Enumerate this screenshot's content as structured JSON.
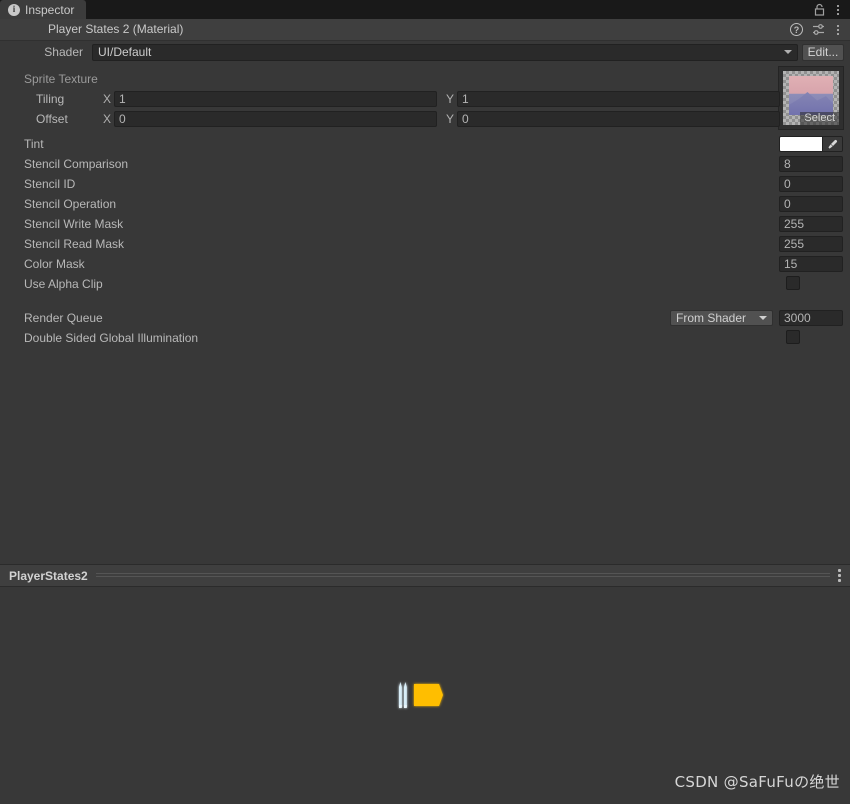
{
  "window": {
    "tab_label": "Inspector",
    "tab_icon": "info-icon",
    "lock_icon": "lock-icon",
    "tab_menu_icon": "kebab-menu-icon"
  },
  "material": {
    "title": "Player States 2 (Material)",
    "help_icon": "help-icon",
    "preset_icon": "preset-sliders-icon",
    "menu_icon": "kebab-menu-icon",
    "shader": {
      "label": "Shader",
      "value": "UI/Default",
      "edit_label": "Edit...",
      "dropdown_icon": "chevron-down-icon"
    }
  },
  "properties": {
    "sprite_texture": {
      "label": "Sprite Texture",
      "select_label": "Select",
      "tiling": {
        "label": "Tiling",
        "x_axis": "X",
        "x": "1",
        "y_axis": "Y",
        "y": "1"
      },
      "offset": {
        "label": "Offset",
        "x_axis": "X",
        "x": "0",
        "y_axis": "Y",
        "y": "0"
      }
    },
    "tint": {
      "label": "Tint",
      "color": "#ffffff",
      "eyedropper_icon": "eyedropper-icon"
    },
    "rows": [
      {
        "label": "Stencil Comparison",
        "value": "8"
      },
      {
        "label": "Stencil ID",
        "value": "0"
      },
      {
        "label": "Stencil Operation",
        "value": "0"
      },
      {
        "label": "Stencil Write Mask",
        "value": "255"
      },
      {
        "label": "Stencil Read Mask",
        "value": "255"
      },
      {
        "label": "Color Mask",
        "value": "15"
      }
    ],
    "use_alpha_clip": {
      "label": "Use Alpha Clip",
      "checked": false
    },
    "render_queue": {
      "label": "Render Queue",
      "mode": "From Shader",
      "value": "3000",
      "dropdown_icon": "chevron-down-icon"
    },
    "double_sided_gi": {
      "label": "Double Sided Global Illumination",
      "checked": false
    }
  },
  "preview": {
    "title": "PlayerStates2",
    "menu_icon": "kebab-menu-icon"
  },
  "watermark": "CSDN @SaFuFuの绝世",
  "colors": {
    "background": "#383838",
    "header": "#3f3f3f",
    "tabbar": "#191919",
    "field": "#2a2a2a",
    "button": "#515151",
    "text": "#b8b8b8",
    "bullet": "#cfe6f2",
    "badge": "#ffbe00"
  }
}
